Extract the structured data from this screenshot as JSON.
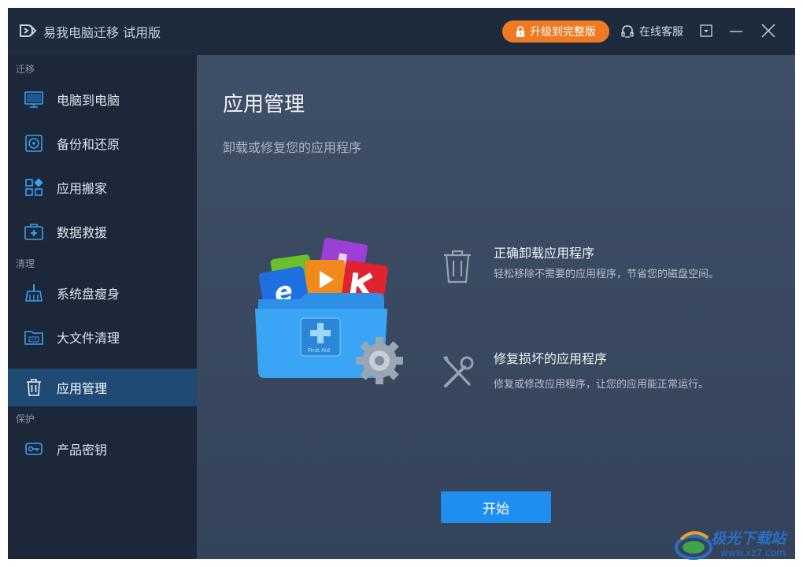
{
  "titlebar": {
    "app_title": "易我电脑迁移 试用版",
    "upgrade_label": "升级到完整版",
    "support_label": "在线客服"
  },
  "sidebar": {
    "sections": [
      {
        "label": "迁移"
      },
      {
        "label": "清理"
      },
      {
        "label": "保护"
      }
    ],
    "items": [
      {
        "label": "电脑到电脑",
        "icon": "monitor-icon"
      },
      {
        "label": "备份和还原",
        "icon": "backup-icon"
      },
      {
        "label": "应用搬家",
        "icon": "apps-icon"
      },
      {
        "label": "数据救援",
        "icon": "rescue-kit-icon"
      },
      {
        "label": "系统盘瘦身",
        "icon": "broom-icon"
      },
      {
        "label": "大文件清理",
        "icon": "folder-gb-icon"
      },
      {
        "label": "应用管理",
        "icon": "trash-icon",
        "active": true
      },
      {
        "label": "产品密钥",
        "icon": "key-icon"
      }
    ]
  },
  "main": {
    "title": "应用管理",
    "subtitle": "卸载或修复您的应用程序",
    "illustration_text": "First Aid",
    "features": [
      {
        "title": "正确卸载应用程序",
        "desc": "轻松移除不需要的应用程序，节省您的磁盘空间。",
        "icon": "trash-icon"
      },
      {
        "title": "修复损坏的应用程序",
        "desc": "修复或修改应用程序，让您的应用能正常运行。",
        "icon": "repair-tools-icon"
      }
    ],
    "start_label": "开始"
  },
  "watermark": {
    "text": "极光下载站",
    "url": "www.xz7.com"
  },
  "colors": {
    "accent": "#1e8ff0",
    "upgrade": "#f07a22",
    "active_item": "#1e4a74"
  }
}
